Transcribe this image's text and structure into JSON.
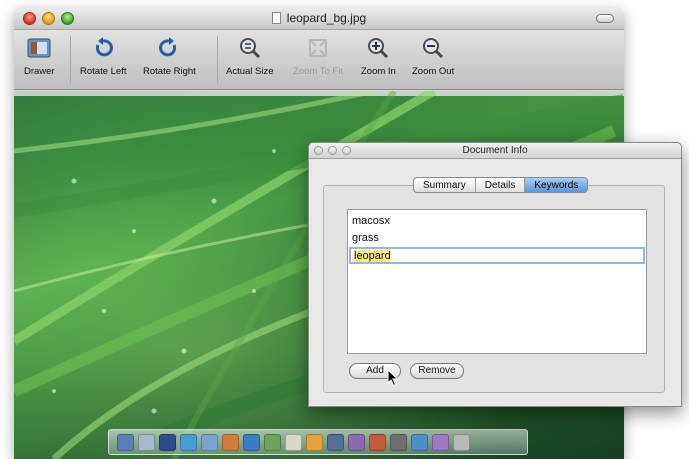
{
  "window": {
    "title": "leopard_bg.jpg"
  },
  "toolbar": {
    "items": [
      {
        "label": "Drawer",
        "icon": "drawer-icon",
        "enabled": true
      },
      {
        "label": "Rotate Left",
        "icon": "rotate-left-icon",
        "enabled": true
      },
      {
        "label": "Rotate Right",
        "icon": "rotate-right-icon",
        "enabled": true
      },
      {
        "label": "Actual Size",
        "icon": "actual-size-icon",
        "enabled": true
      },
      {
        "label": "Zoom To Fit",
        "icon": "zoom-to-fit-icon",
        "enabled": false
      },
      {
        "label": "Zoom In",
        "icon": "zoom-in-icon",
        "enabled": true
      },
      {
        "label": "Zoom Out",
        "icon": "zoom-out-icon",
        "enabled": true
      }
    ]
  },
  "doc_info": {
    "title": "Document Info",
    "tabs": [
      {
        "label": "Summary",
        "active": false
      },
      {
        "label": "Details",
        "active": false
      },
      {
        "label": "Keywords",
        "active": true
      }
    ],
    "keywords": [
      "macosx",
      "grass",
      "leopard"
    ],
    "editing_keyword": "leopard",
    "add_label": "Add",
    "remove_label": "Remove"
  },
  "colors": {
    "accent_tab": "#5c95d8",
    "edit_highlight": "#fdea86",
    "grass": "#4ea84a"
  }
}
